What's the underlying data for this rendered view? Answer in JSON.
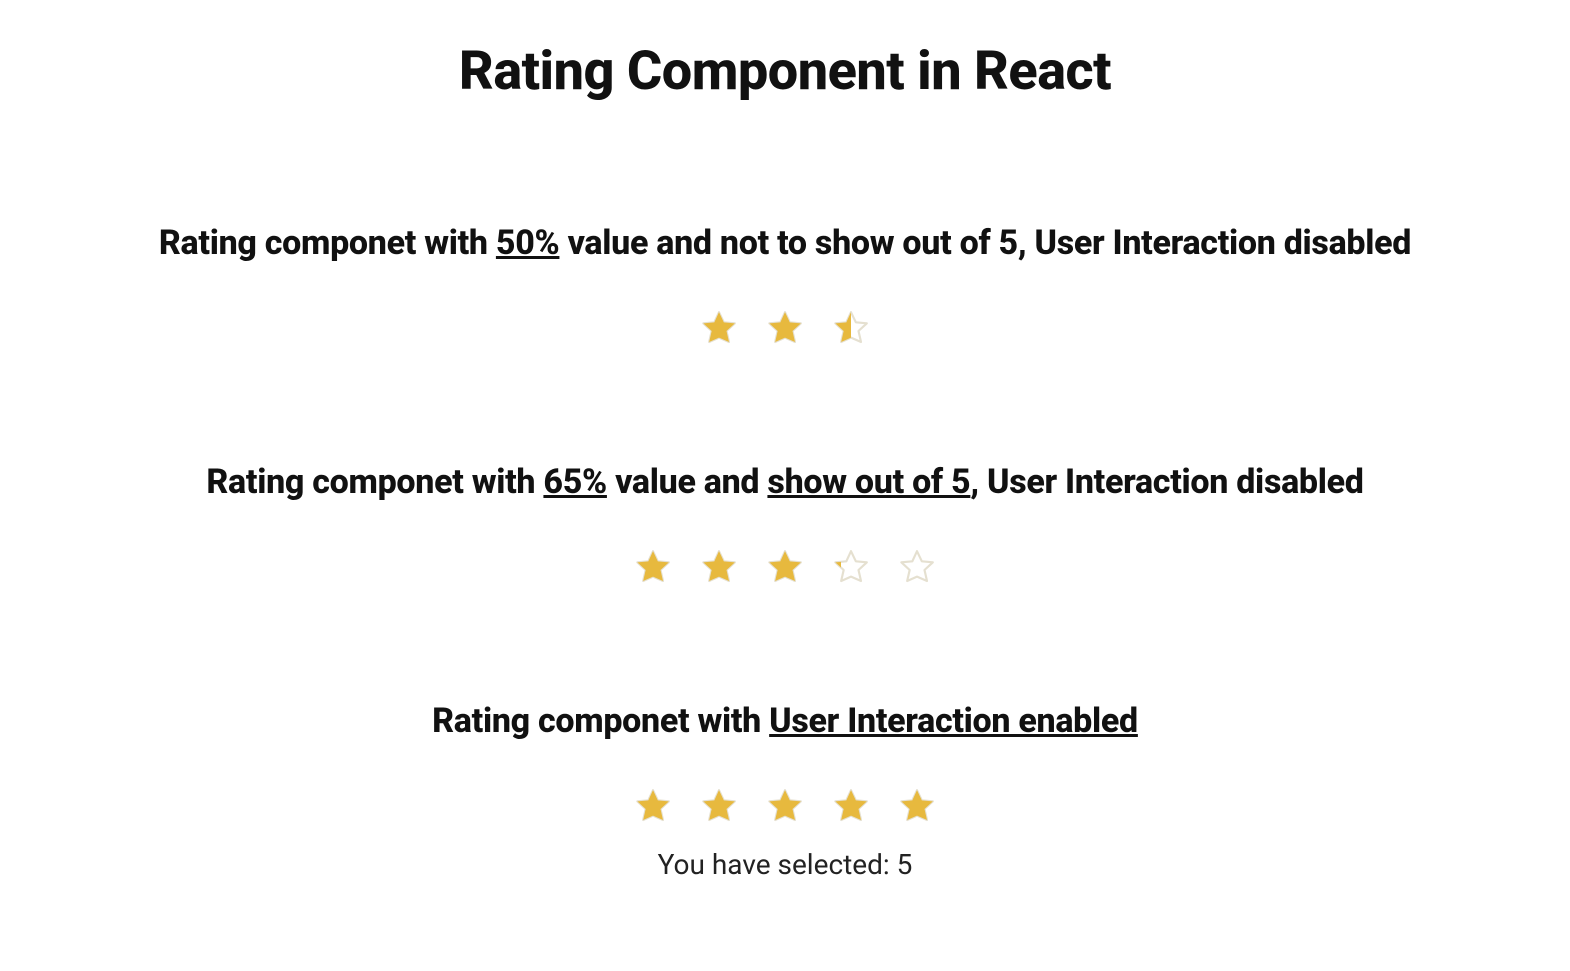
{
  "title": "Rating Component in React",
  "colors": {
    "star_fill": "#E7B93E",
    "star_stroke": "#E5E0D0"
  },
  "examples": [
    {
      "heading_parts": [
        {
          "text": "Rating componet with ",
          "underline": false
        },
        {
          "text": "50%",
          "underline": true
        },
        {
          "text": " value and not to show out of 5, User Interaction disabled",
          "underline": false
        }
      ],
      "value_percent": 50,
      "show_out_of_5": false,
      "interactive": false,
      "caption": null
    },
    {
      "heading_parts": [
        {
          "text": "Rating componet with ",
          "underline": false
        },
        {
          "text": "65%",
          "underline": true
        },
        {
          "text": " value and ",
          "underline": false
        },
        {
          "text": "show out of 5",
          "underline": true
        },
        {
          "text": ", User Interaction disabled",
          "underline": false
        }
      ],
      "value_percent": 65,
      "show_out_of_5": true,
      "interactive": false,
      "caption": null
    },
    {
      "heading_parts": [
        {
          "text": "Rating componet with ",
          "underline": false
        },
        {
          "text": "User Interaction enabled",
          "underline": true
        }
      ],
      "value_percent": 100,
      "show_out_of_5": true,
      "interactive": true,
      "selected_value": 5,
      "caption_prefix": "You have selected: "
    }
  ]
}
